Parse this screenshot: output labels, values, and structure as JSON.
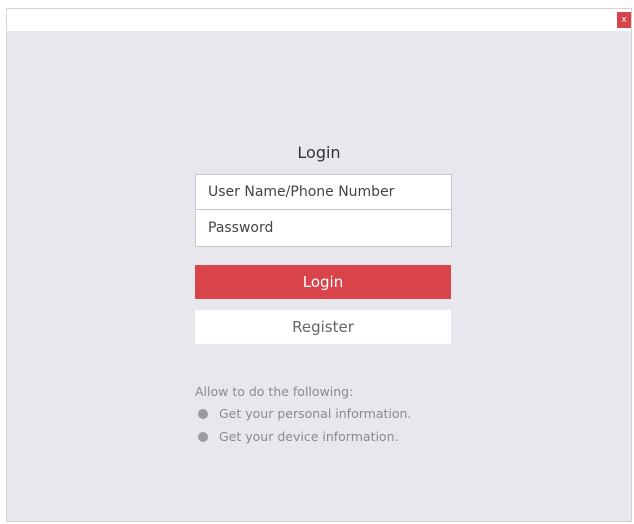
{
  "window": {
    "close_label": "x"
  },
  "login": {
    "title": "Login",
    "username_placeholder": "User Name/Phone Number",
    "password_placeholder": "Password",
    "login_button": "Login",
    "register_button": "Register"
  },
  "permissions": {
    "heading": "Allow to do the following:",
    "items": [
      "Get your personal information.",
      "Get your device information."
    ]
  },
  "colors": {
    "accent": "#d9434a",
    "background": "#e8e7ed"
  }
}
